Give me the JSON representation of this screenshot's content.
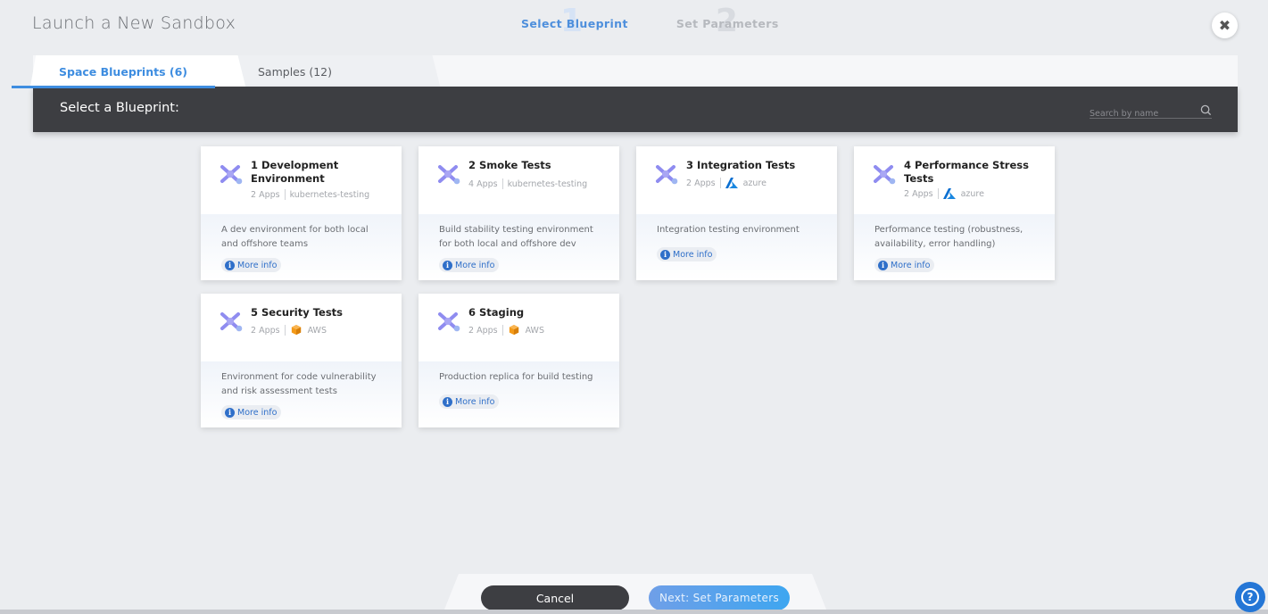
{
  "window": {
    "title": "Launch a New Sandbox"
  },
  "steps": [
    {
      "number": "1",
      "label": "Select Blueprint"
    },
    {
      "number": "2",
      "label": "Set Parameters"
    }
  ],
  "tabs": [
    {
      "label": "Space Blueprints (6)"
    },
    {
      "label": "Samples (12)"
    }
  ],
  "panel": {
    "heading": "Select a Blueprint:",
    "search_placeholder": "Search by name"
  },
  "blueprints": [
    {
      "name": "1 Development Environment",
      "apps": "2 Apps",
      "provider": "kubernetes-testing",
      "provider_icon": "",
      "description": "A dev environment for both local and offshore teams",
      "more_info": "More info"
    },
    {
      "name": "2 Smoke Tests",
      "apps": "4 Apps",
      "provider": "kubernetes-testing",
      "provider_icon": "",
      "description": "Build stability testing environment for both local and offshore dev",
      "more_info": "More info"
    },
    {
      "name": "3 Integration Tests",
      "apps": "2 Apps",
      "provider": "azure",
      "provider_icon": "azure-icon",
      "description": "Integration testing environment",
      "more_info": "More info"
    },
    {
      "name": "4 Performance Stress Tests",
      "apps": "2 Apps",
      "provider": "azure",
      "provider_icon": "azure-icon",
      "description": "Performance testing (robustness, availability, error handling)",
      "more_info": "More info"
    },
    {
      "name": "5 Security Tests",
      "apps": "2 Apps",
      "provider": "AWS",
      "provider_icon": "aws-icon",
      "description": "Environment for code vulnerability and risk assessment tests",
      "more_info": "More info"
    },
    {
      "name": "6 Staging",
      "apps": "2 Apps",
      "provider": "AWS",
      "provider_icon": "aws-icon",
      "description": "Production replica for build testing",
      "more_info": "More info"
    }
  ],
  "footer": {
    "cancel_label": "Cancel",
    "next_label": "Next: Set Parameters",
    "help_label": "?"
  },
  "colors": {
    "accent": "#3e8de0",
    "dark_bar": "#3d3e42",
    "help": "#2476d6"
  }
}
